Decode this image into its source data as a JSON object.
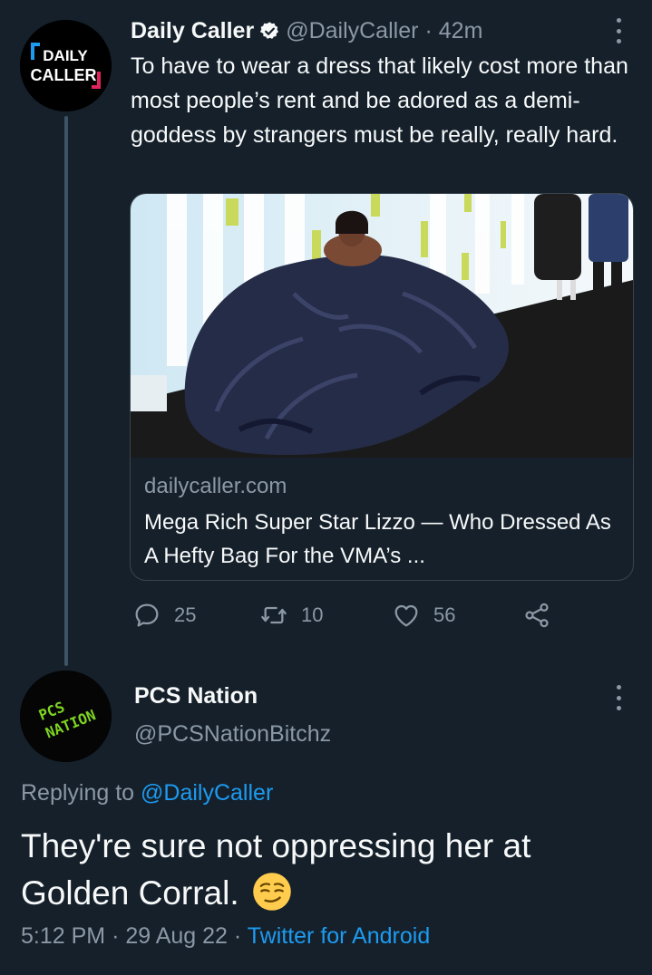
{
  "tweet": {
    "author_name": "Daily Caller",
    "author_handle": "@DailyCaller",
    "separator": "·",
    "time_ago": "42m",
    "avatar_text_line1": "DAILY",
    "avatar_text_line2": "CALLER",
    "text": "To have to wear a dress that likely cost more than most people’s rent and be adored as a demi-goddess by strangers must be really, really hard.",
    "card": {
      "domain": "dailycaller.com",
      "title": "Mega Rich Super Star Lizzo — Who Dressed As A Hefty Bag For the VMA’s ...",
      "image_icon": "photo-lizzo-vma-red-carpet"
    },
    "actions": {
      "reply_count": "25",
      "retweet_count": "10",
      "like_count": "56"
    }
  },
  "reply": {
    "author_name": "PCS Nation",
    "author_handle": "@PCSNationBitchz",
    "avatar_text_line1": "PCS",
    "avatar_text_line2": "NATION",
    "replying_prefix": "Replying to",
    "replying_to": "@DailyCaller",
    "text": "They're sure not oppressing her at Golden Corral.",
    "emoji_icon": "smirking-face-emoji",
    "time": "5:12 PM",
    "date": "29 Aug 22",
    "separator": "·",
    "source": "Twitter for Android"
  },
  "colors": {
    "background": "#15202b",
    "text": "#f7f9f9",
    "secondary": "#8b98a5",
    "link": "#1d9bf0",
    "border": "#38444d",
    "thread_line": "#3d5466"
  }
}
